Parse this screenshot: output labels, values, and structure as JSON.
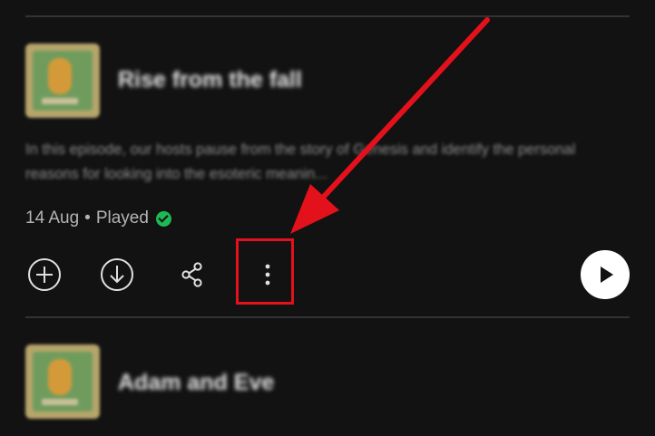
{
  "episodes": [
    {
      "title": "Rise from the fall",
      "description": "In this episode, our hosts pause from the story of Genesis and identify the personal reasons for looking into the esoteric meanin...",
      "date": "14 Aug",
      "separator": "•",
      "status": "Played"
    },
    {
      "title": "Adam and Eve"
    }
  ],
  "icons": {
    "add": "plus-circle-icon",
    "download": "download-circle-icon",
    "share": "share-icon",
    "more": "more-vertical-icon",
    "play": "play-icon",
    "played": "check-circle-icon"
  },
  "colors": {
    "background": "#121212",
    "played_check": "#1db954",
    "annotation": "#e3111b"
  }
}
